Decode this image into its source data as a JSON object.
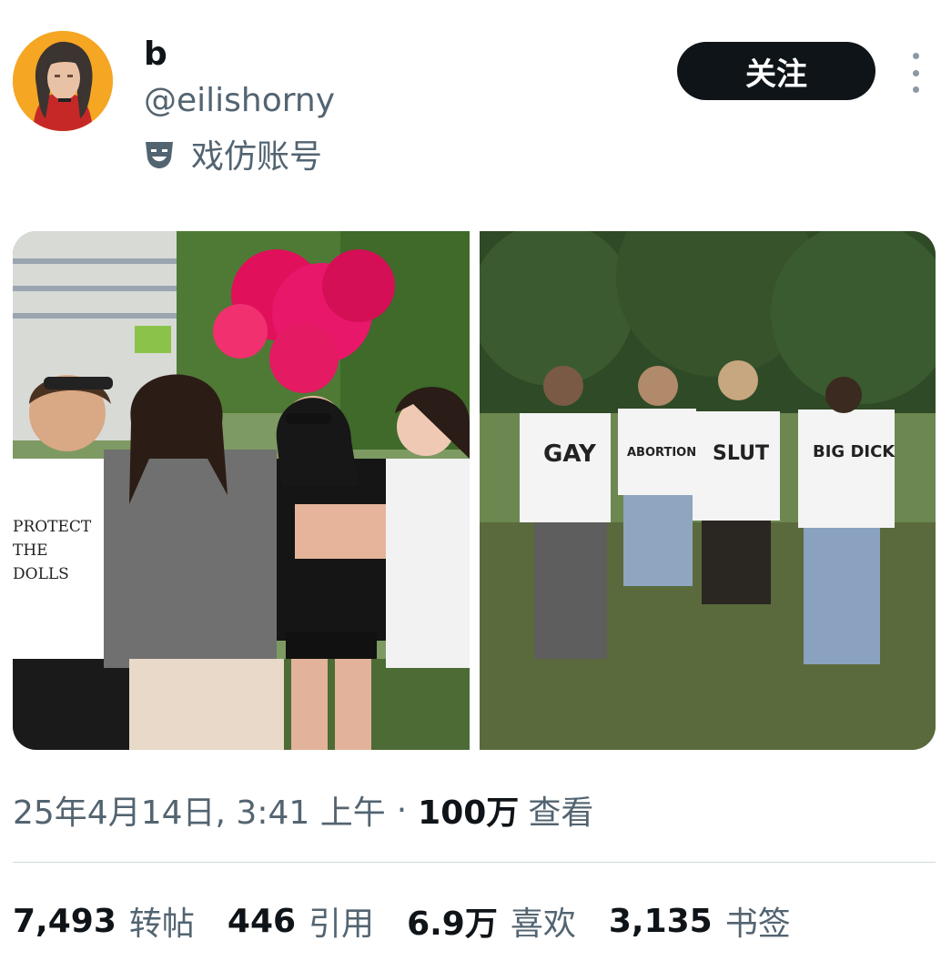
{
  "user": {
    "display_name": "b",
    "handle": "@eilishorny",
    "parody_label": "戏仿账号",
    "parody_icon": "theater-mask-icon"
  },
  "follow_label": "关注",
  "tweet": {
    "date": "25年4月14日, 3:41 上午",
    "separator": "·",
    "views_count": "100万",
    "views_label": "查看"
  },
  "photos": {
    "left": {
      "shirt_text": [
        "PROTECT",
        "THE",
        "DOLLS"
      ]
    },
    "right": {
      "shirts": [
        "GAY",
        "ABORTION",
        "SLUT",
        "BIG DICK"
      ]
    }
  },
  "stats": [
    {
      "count": "7,493",
      "label": "转帖"
    },
    {
      "count": "446",
      "label": "引用"
    },
    {
      "count": "6.9万",
      "label": "喜欢"
    },
    {
      "count": "3,135",
      "label": "书签"
    }
  ],
  "colors": {
    "text_primary": "#0f1419",
    "text_secondary": "#536471",
    "follow_bg": "#0f1419",
    "divider": "#cfd9de"
  }
}
